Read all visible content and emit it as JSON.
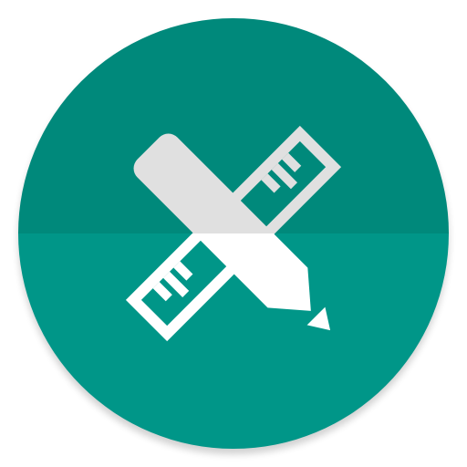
{
  "icon": {
    "name": "pencil-ruler-app-icon",
    "shape": "circle",
    "colors": {
      "background_top": "#00897B",
      "background_bottom": "#009688",
      "glyph_light": "#FFFFFF",
      "glyph_shaded": "#E0E0E0",
      "shadow": "#000000"
    }
  }
}
